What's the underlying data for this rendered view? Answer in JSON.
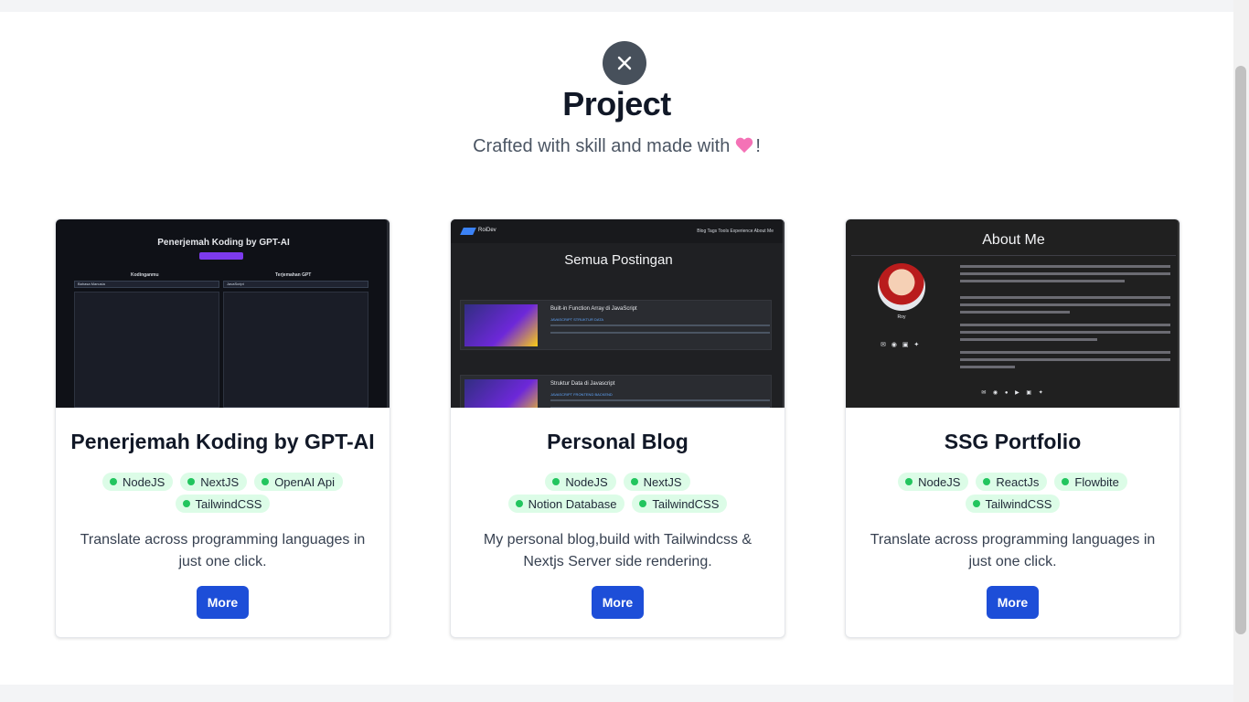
{
  "header": {
    "title": "Project",
    "subtitle": "Crafted with skill and made with",
    "subtitle_end": "!"
  },
  "icons": {
    "close": "close-icon",
    "heart": "heart-emoji"
  },
  "projects": [
    {
      "title": "Penerjemah Koding by GPT-AI",
      "tags": [
        "NodeJS",
        "NextJS",
        "OpenAI Api",
        "TailwindCSS"
      ],
      "description": "Translate across programming languages in just one click.",
      "button": "More",
      "preview": {
        "heading": "Penerjemah Koding by GPT-AI",
        "left_label": "Kodinganmu",
        "right_label": "Terjemahan GPT",
        "left_select": "Bahasa Manusia",
        "right_select": "JavaScript"
      }
    },
    {
      "title": "Personal Blog",
      "tags": [
        "NodeJS",
        "NextJS",
        "Notion Database",
        "TailwindCSS"
      ],
      "description": "My personal blog,build with Tailwindcss & Nextjs Server side rendering.",
      "button": "More",
      "preview": {
        "brand": "RoiDev",
        "nav": "Blog  Tags  Tools  Experience  About Me",
        "heading": "Semua Postingan",
        "post1": "Built-in Function Array di JavaScript",
        "post1_tags": "JAVASCRIPT  STRUKTUR DATA",
        "post2": "Struktur Data di Javascript",
        "post2_tags": "JAVASCRIPT  FRONTEND  BACKEND"
      }
    },
    {
      "title": "SSG Portfolio",
      "tags": [
        "NodeJS",
        "ReactJs",
        "Flowbite",
        "TailwindCSS"
      ],
      "description": "Translate across programming languages in just one click.",
      "button": "More",
      "preview": {
        "heading": "About Me",
        "name": "Roy"
      }
    }
  ],
  "colors": {
    "tag_bg": "#dcfce7",
    "tag_dot": "#22c55e",
    "button": "#1d4ed8",
    "heart": "#f472b6"
  }
}
